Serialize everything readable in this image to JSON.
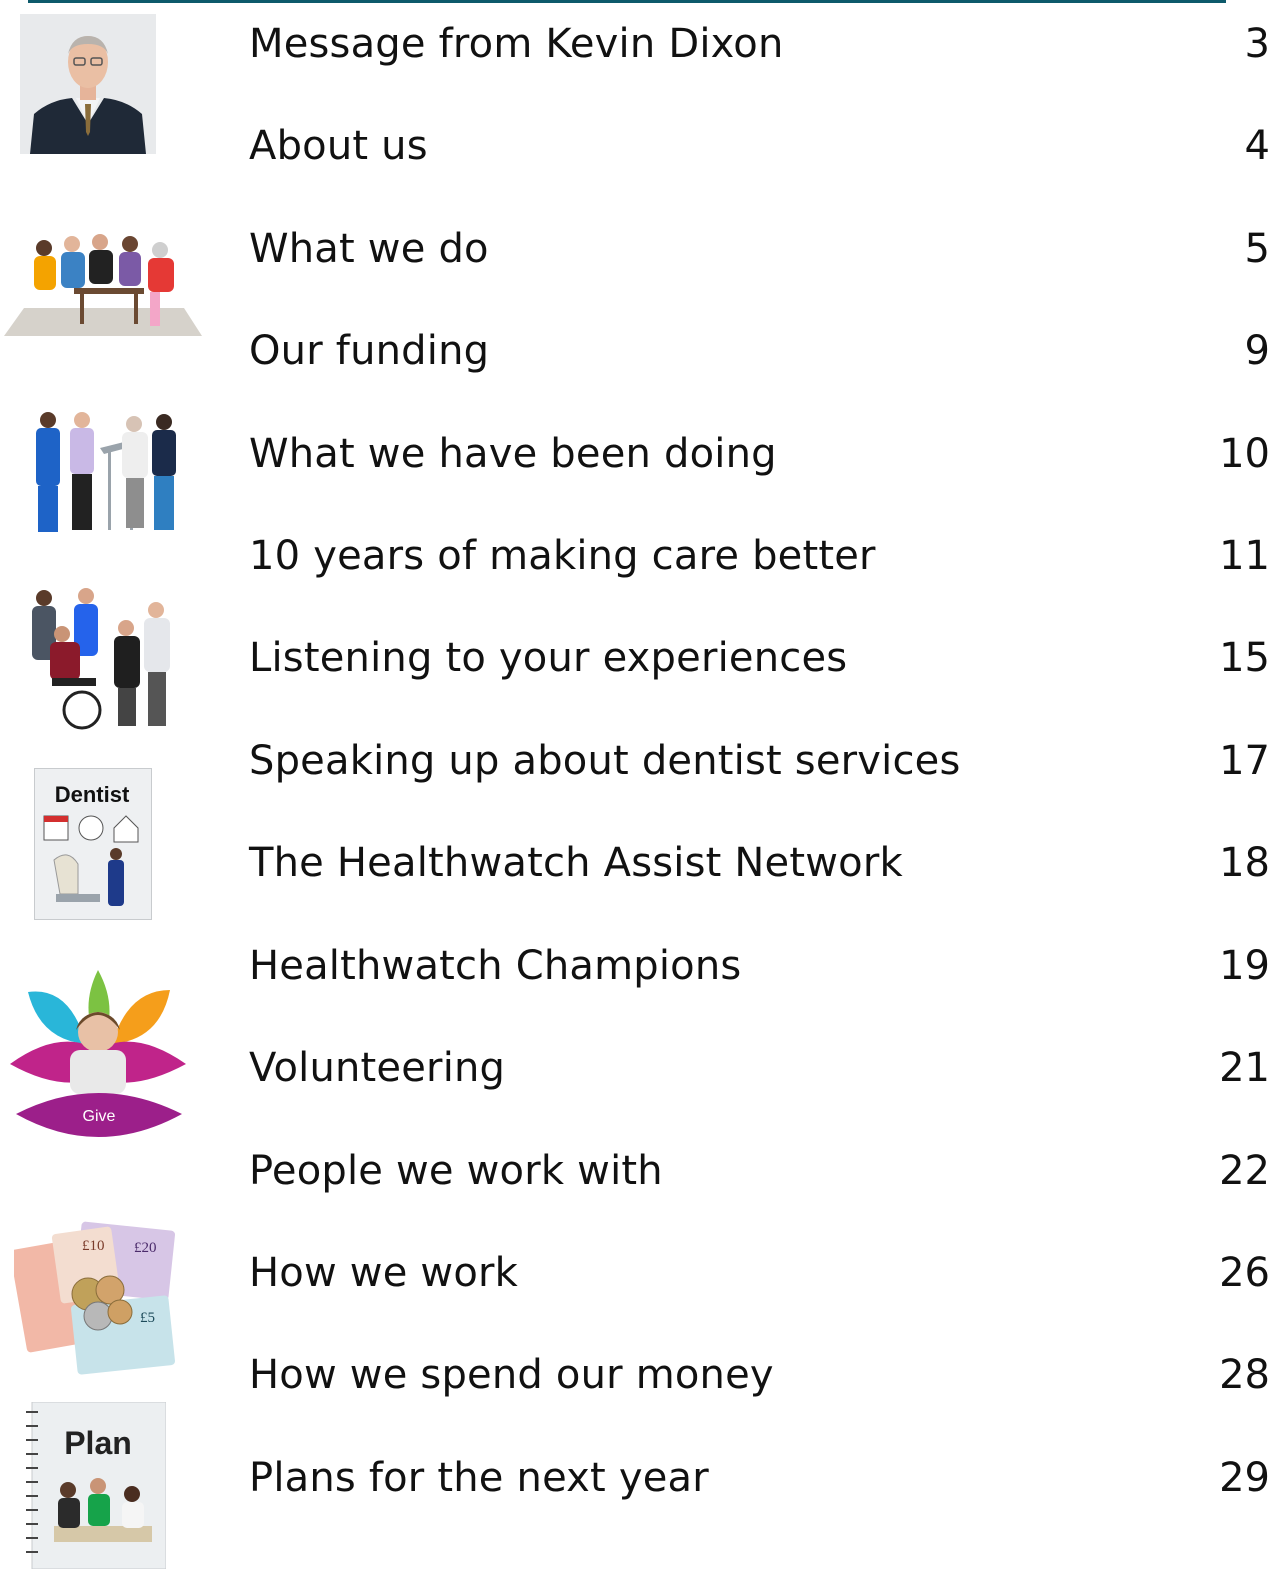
{
  "contents": [
    {
      "title": "Message from Kevin Dixon",
      "page": "3"
    },
    {
      "title": "About us",
      "page": "4"
    },
    {
      "title": "What we do",
      "page": "5"
    },
    {
      "title": "Our funding",
      "page": "9"
    },
    {
      "title": "What we have been doing",
      "page": "10"
    },
    {
      "title": "10 years of making care better",
      "page": "11"
    },
    {
      "title": "Listening to your experiences",
      "page": "15"
    },
    {
      "title": "Speaking up about dentist services",
      "page": "17"
    },
    {
      "title": "The Healthwatch Assist Network",
      "page": "18"
    },
    {
      "title": "Healthwatch Champions",
      "page": "19"
    },
    {
      "title": "Volunteering",
      "page": "21"
    },
    {
      "title": "People we work with",
      "page": "22"
    },
    {
      "title": "How we work",
      "page": "26"
    },
    {
      "title": "How we spend our money",
      "page": "28"
    },
    {
      "title": "Plans for the next year",
      "page": "29"
    }
  ],
  "illustrations": {
    "dentist_label": "Dentist",
    "give_label": "Give",
    "plan_label": "Plan",
    "note_10": "£10",
    "note_20": "£20",
    "note_5": "£5"
  }
}
